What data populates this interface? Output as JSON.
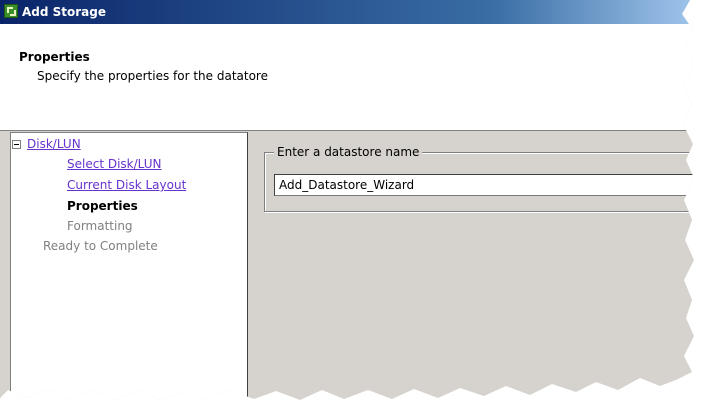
{
  "window": {
    "title": "Add Storage",
    "icon": "vsphere-app-icon"
  },
  "header": {
    "title": "Properties",
    "subtitle": "Specify the properties for the datatore"
  },
  "nav": {
    "group_label": "Disk/LUN",
    "expander_state": "expanded",
    "items": [
      {
        "label": "Select Disk/LUN",
        "state": "link"
      },
      {
        "label": "Current Disk Layout",
        "state": "link"
      },
      {
        "label": "Properties",
        "state": "current"
      },
      {
        "label": "Formatting",
        "state": "disabled"
      },
      {
        "label": "Ready to Complete",
        "state": "disabled"
      }
    ]
  },
  "form": {
    "group_label": "Enter a datastore name",
    "datastore_name": "Add_Datastore_Wizard"
  },
  "colors": {
    "titlebar": "#0a246a",
    "link": "#6633cc",
    "dialog_bg": "#d6d3ce"
  }
}
